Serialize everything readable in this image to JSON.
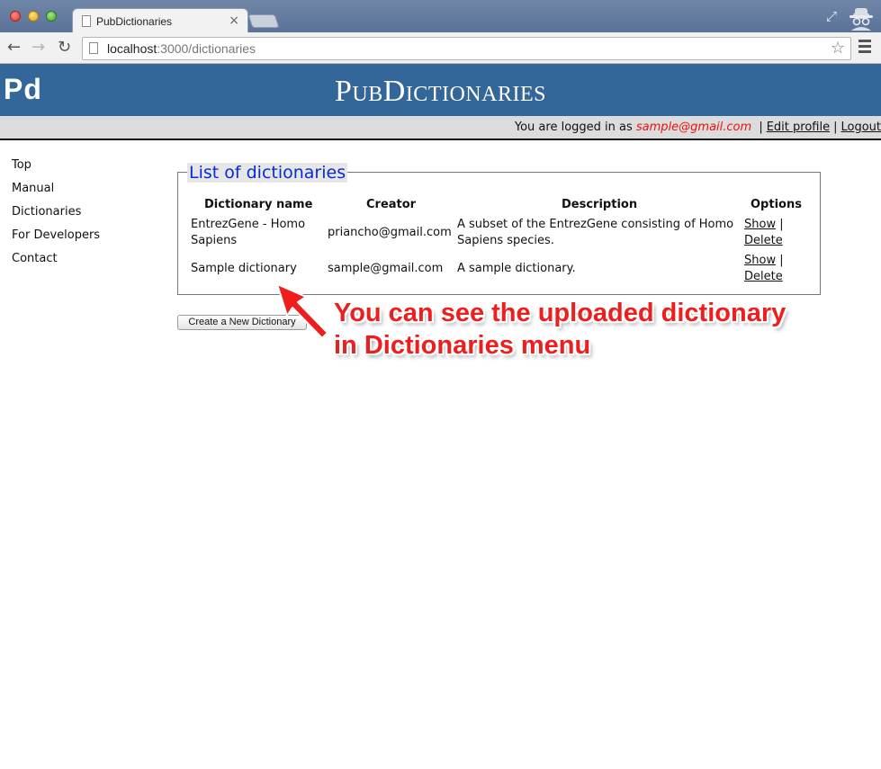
{
  "browser": {
    "tab_title": "PubDictionaries",
    "tab_close": "×",
    "url_host": "localhost",
    "url_path": ":3000/dictionaries",
    "icons": [
      "back-icon",
      "forward-icon",
      "reload-icon",
      "page-icon",
      "star-icon",
      "menu-icon",
      "fullscreen-icon",
      "incognito-icon"
    ]
  },
  "header": {
    "logo": "Pd",
    "title": "PubDictionaries",
    "background": "#336699"
  },
  "userbar": {
    "prefix": "You are logged in as",
    "email": "sample@gmail.com",
    "separator": "|",
    "edit_profile": "Edit profile",
    "logout": "Logout"
  },
  "sidebar": {
    "items": [
      {
        "label": "Top"
      },
      {
        "label": "Manual"
      },
      {
        "label": "Dictionaries"
      },
      {
        "label": "For Developers"
      },
      {
        "label": "Contact"
      }
    ]
  },
  "main": {
    "legend": "List of dictionaries",
    "columns": [
      "Dictionary name",
      "Creator",
      "Description",
      "Options"
    ],
    "rows": [
      {
        "name_line1": "EntrezGene - Homo",
        "name_line2": "Sapiens",
        "creator": "priancho@gmail.com",
        "desc_line1": "A subset of the EntrezGene consisting of Homo",
        "desc_line2": "Sapiens species.",
        "show": "Show",
        "sep": "|",
        "delete": "Delete"
      },
      {
        "name_line1": "Sample dictionary",
        "name_line2": "",
        "creator": "sample@gmail.com",
        "desc_line1": "A sample dictionary.",
        "desc_line2": "",
        "show": "Show",
        "sep": "|",
        "delete": "Delete"
      }
    ],
    "new_button": "Create a New Dictionary"
  },
  "annotation": {
    "line1": "You can see the uploaded dictionary",
    "line2": "in Dictionaries menu",
    "color": "#ee1e1e"
  }
}
